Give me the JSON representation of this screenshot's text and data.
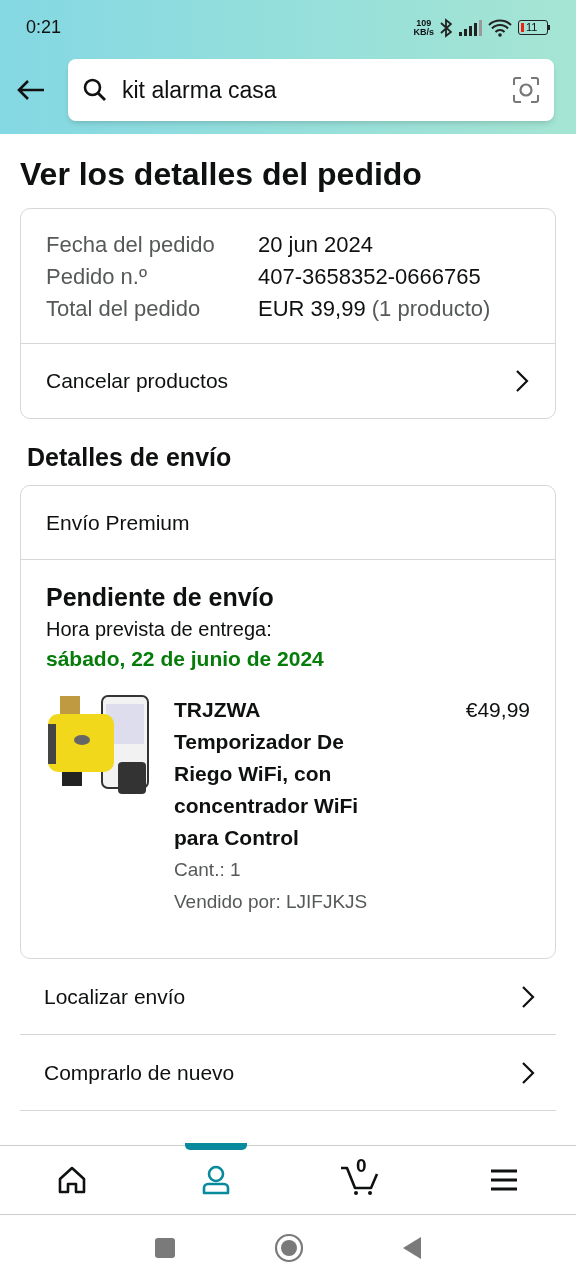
{
  "status_bar": {
    "time": "0:21",
    "net_speed_value": "109",
    "net_speed_unit": "KB/s",
    "battery": "11"
  },
  "search": {
    "value": "kit alarma casa"
  },
  "title": "Ver los detalles del pedido",
  "order": {
    "rows": [
      {
        "label": "Fecha del pedido",
        "value": "20 jun 2024"
      },
      {
        "label": "Pedido n.º",
        "value": "407-3658352-0666765"
      },
      {
        "label": "Total del pedido",
        "value": "EUR 39,99",
        "note": "(1 producto)"
      }
    ],
    "action": "Cancelar productos"
  },
  "shipping": {
    "heading": "Detalles de envío",
    "method": "Envío Premium",
    "status": "Pendiente de envío",
    "eta_label": "Hora prevista de entrega:",
    "eta": "sábado, 22 de junio de 2024",
    "item": {
      "name": "TRJZWA Temporizador De Riego WiFi, con concentrador WiFi para Control",
      "price": "€49,99",
      "qty": "Cant.: 1",
      "seller": "Vendido por: LJIFJKJS"
    }
  },
  "links": [
    "Localizar envío",
    "Comprarlo de nuevo"
  ],
  "nav": [
    {
      "kind": "home",
      "selected": false
    },
    {
      "kind": "account",
      "selected": true
    },
    {
      "kind": "cart",
      "selected": false,
      "count": "0"
    },
    {
      "kind": "menu",
      "selected": false
    }
  ]
}
